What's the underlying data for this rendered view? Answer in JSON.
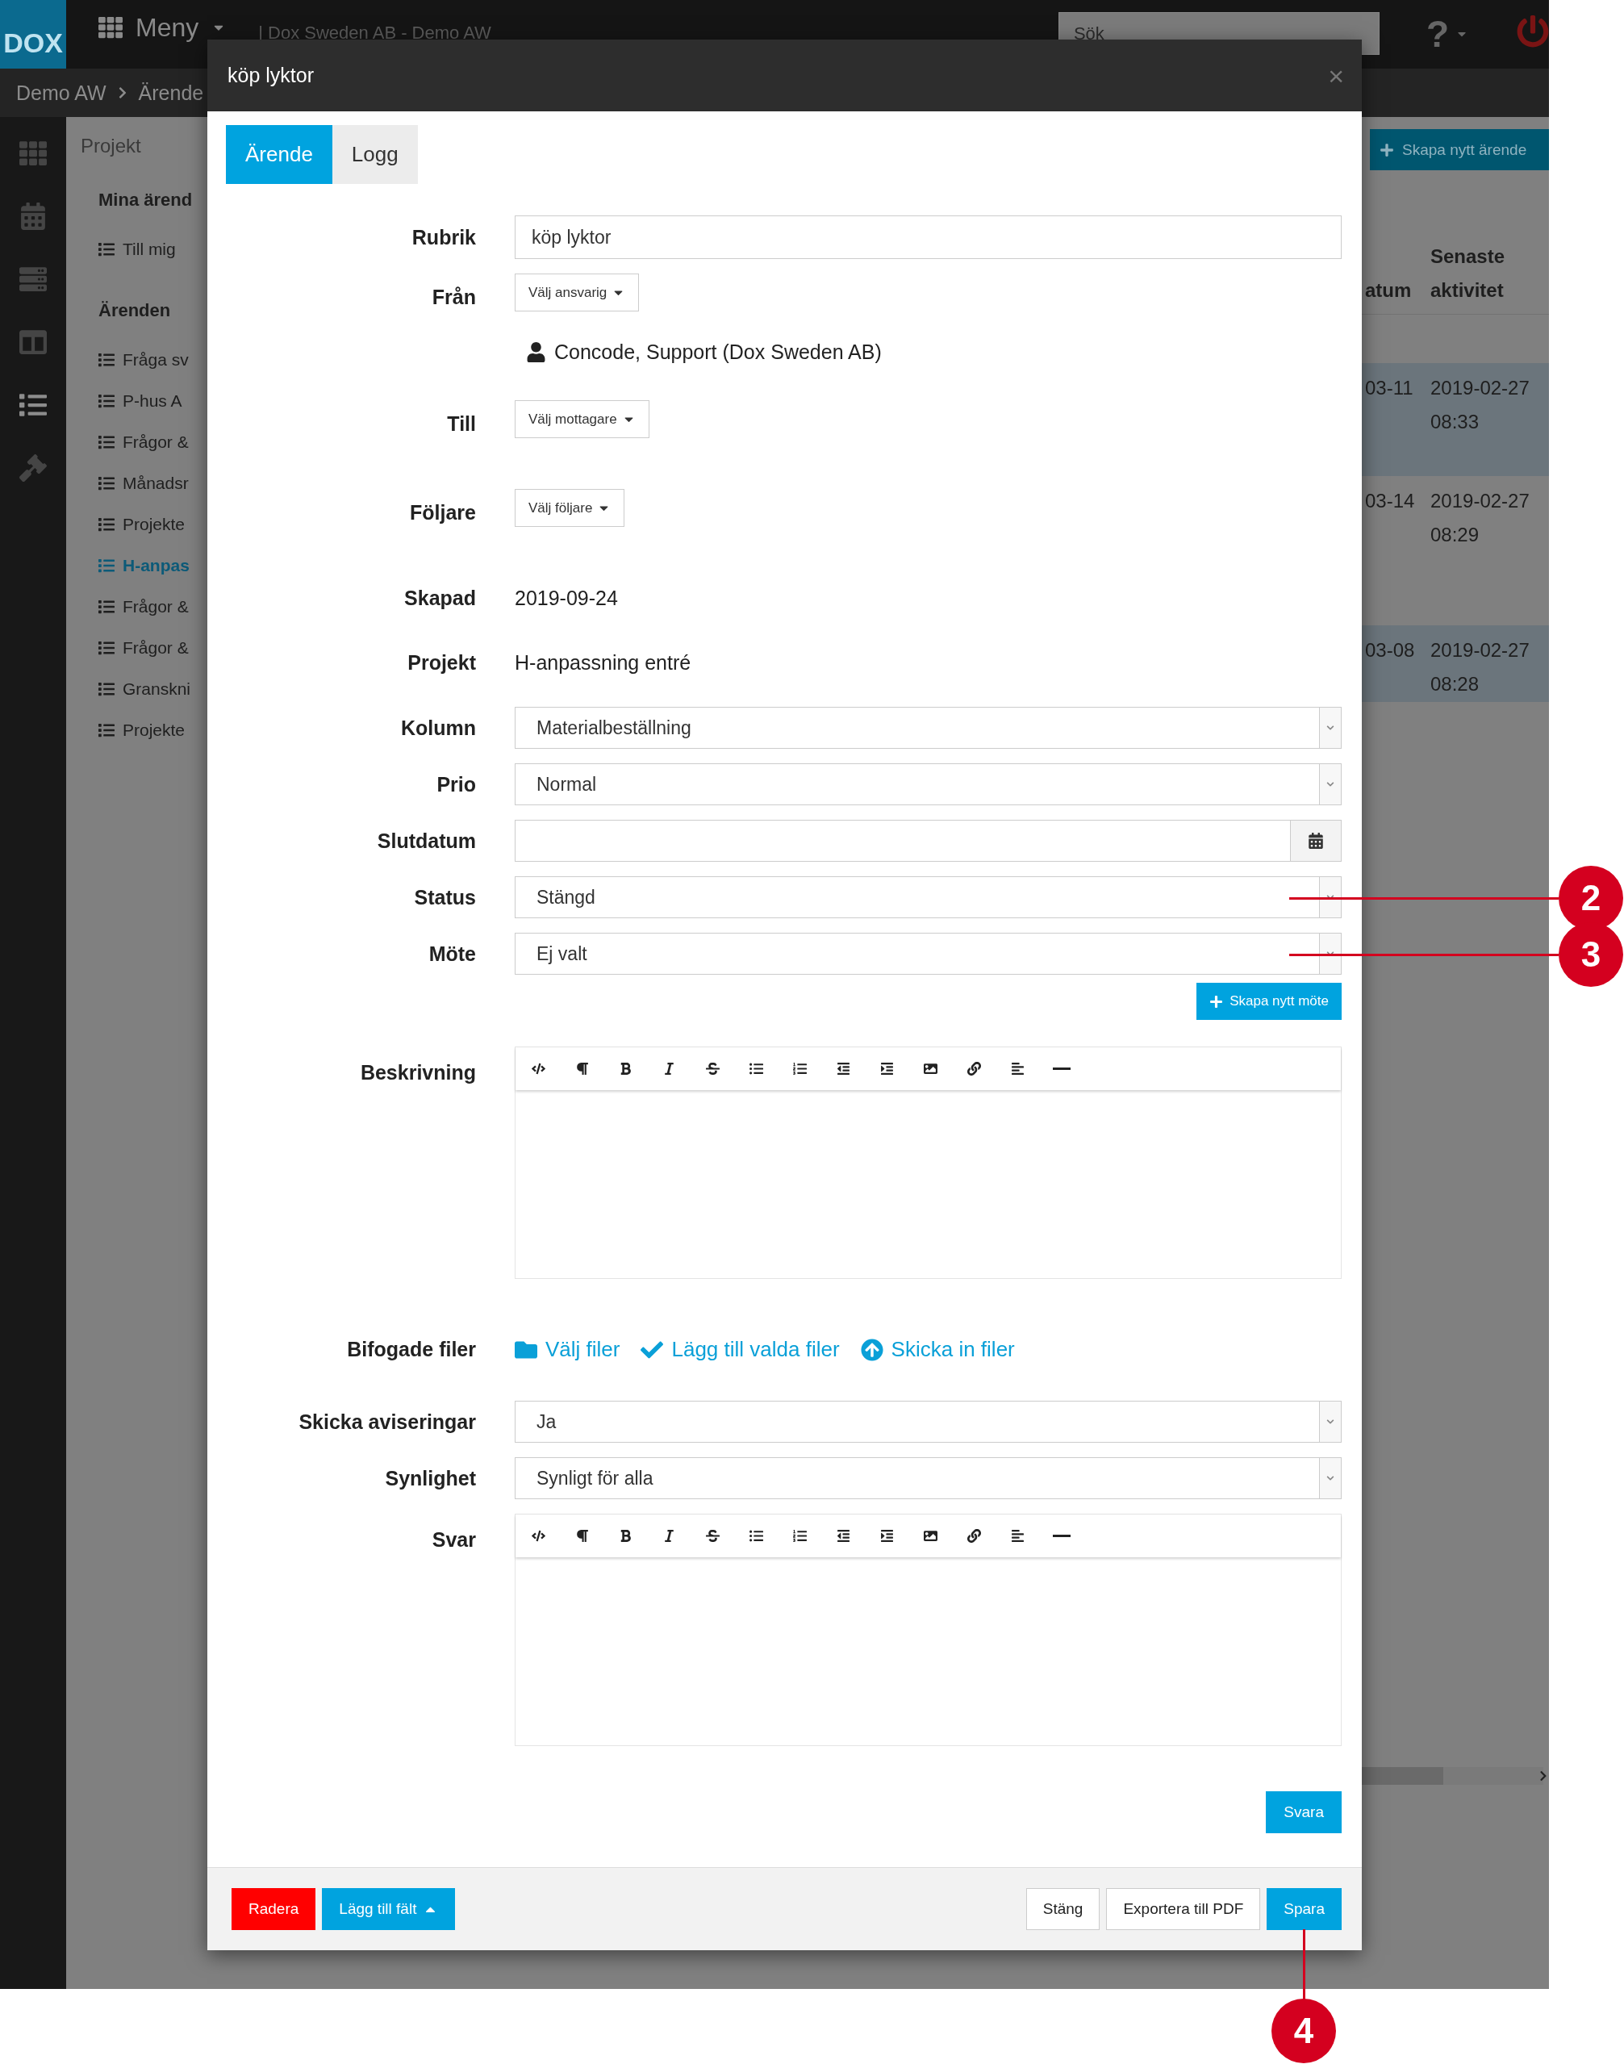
{
  "top_bar": {
    "logo": "DOX",
    "menu": "Meny",
    "org": "| Dox Sweden AB - Demo AW",
    "search_placeholder": "Sök",
    "help": "?"
  },
  "breadcrumb": [
    "Demo AW",
    "Ärende"
  ],
  "sidebar_nav": [
    {
      "selected": false
    },
    {
      "selected": false
    },
    {
      "selected": false
    },
    {
      "selected": false
    },
    {
      "selected": true
    },
    {
      "selected": false
    }
  ],
  "project_panel": {
    "title": "Projekt",
    "groups": [
      {
        "heading": "Mina ärend",
        "items": [
          {
            "label": "Till mig",
            "selected": false
          }
        ]
      },
      {
        "heading": "Ärenden",
        "items": [
          {
            "label": "Fråga sv",
            "selected": false
          },
          {
            "label": "P-hus A",
            "selected": false
          },
          {
            "label": "Frågor &",
            "selected": false
          },
          {
            "label": "Månadsr",
            "selected": false
          },
          {
            "label": "Projekte",
            "selected": false
          },
          {
            "label": "H-anpas",
            "selected": true
          },
          {
            "label": "Frågor &",
            "selected": false
          },
          {
            "label": "Frågor &",
            "selected": false
          },
          {
            "label": "Granskni",
            "selected": false
          },
          {
            "label": "Projekte",
            "selected": false
          }
        ]
      }
    ]
  },
  "background_table": {
    "create_button": "Skapa nytt ärende",
    "columns": [
      "atum",
      "Senaste aktivitet"
    ],
    "rows": [
      {
        "cells": [
          "03-11",
          "2019-02-27 08:33"
        ],
        "selected": true
      },
      {
        "cells": [
          "03-14",
          "2019-02-27 08:29"
        ],
        "selected": false
      },
      {
        "cells": [
          "03-08",
          "2019-02-27 08:28"
        ],
        "selected": true
      }
    ]
  },
  "modal": {
    "title": "köp lyktor",
    "close": "×",
    "tabs": [
      {
        "label": "Ärende",
        "selected": true
      },
      {
        "label": "Logg",
        "selected": false
      }
    ],
    "fields": [
      {
        "kind": "input",
        "label": "Rubrik",
        "value": "köp lyktor"
      },
      {
        "kind": "picker",
        "label": "Från",
        "button": "Välj ansvarig",
        "people": [
          "Concode, Support (Dox Sweden AB)"
        ]
      },
      {
        "kind": "picker",
        "label": "Till",
        "button": "Välj mottagare"
      },
      {
        "kind": "picker",
        "label": "Följare",
        "button": "Välj följare"
      },
      {
        "kind": "static",
        "label": "Skapad",
        "value": "2019-09-24"
      },
      {
        "kind": "static",
        "label": "Projekt",
        "value": "H-anpassning entré"
      },
      {
        "kind": "select",
        "label": "Kolumn",
        "value": "Materialbeställning"
      },
      {
        "kind": "select",
        "label": "Prio",
        "value": "Normal"
      },
      {
        "kind": "date",
        "label": "Slutdatum"
      },
      {
        "kind": "select",
        "label": "Status",
        "value": "Stängd"
      },
      {
        "kind": "select",
        "label": "Möte",
        "value": "Ej valt",
        "action": "Skapa nytt möte"
      },
      {
        "kind": "editor",
        "label": "Beskrivning"
      },
      {
        "kind": "files",
        "label": "Bifogade filer",
        "links": [
          "Välj filer",
          "Lägg till valda filer",
          "Skicka in filer"
        ]
      },
      {
        "kind": "select",
        "label": "Skicka aviseringar",
        "value": "Ja"
      },
      {
        "kind": "select",
        "label": "Synlighet",
        "value": "Synligt för alla"
      },
      {
        "kind": "editor",
        "label": "Svar",
        "action": "Svara"
      }
    ],
    "footer_left": [
      {
        "kind": "danger",
        "label": "Radera"
      },
      {
        "kind": "dropdown",
        "label": "Lägg till fält"
      }
    ],
    "footer_right": [
      {
        "kind": "default",
        "label": "Stäng"
      },
      {
        "kind": "default",
        "label": "Exportera till PDF"
      },
      {
        "kind": "primary",
        "label": "Spara"
      }
    ]
  },
  "callouts": [
    "2",
    "3",
    "4"
  ]
}
